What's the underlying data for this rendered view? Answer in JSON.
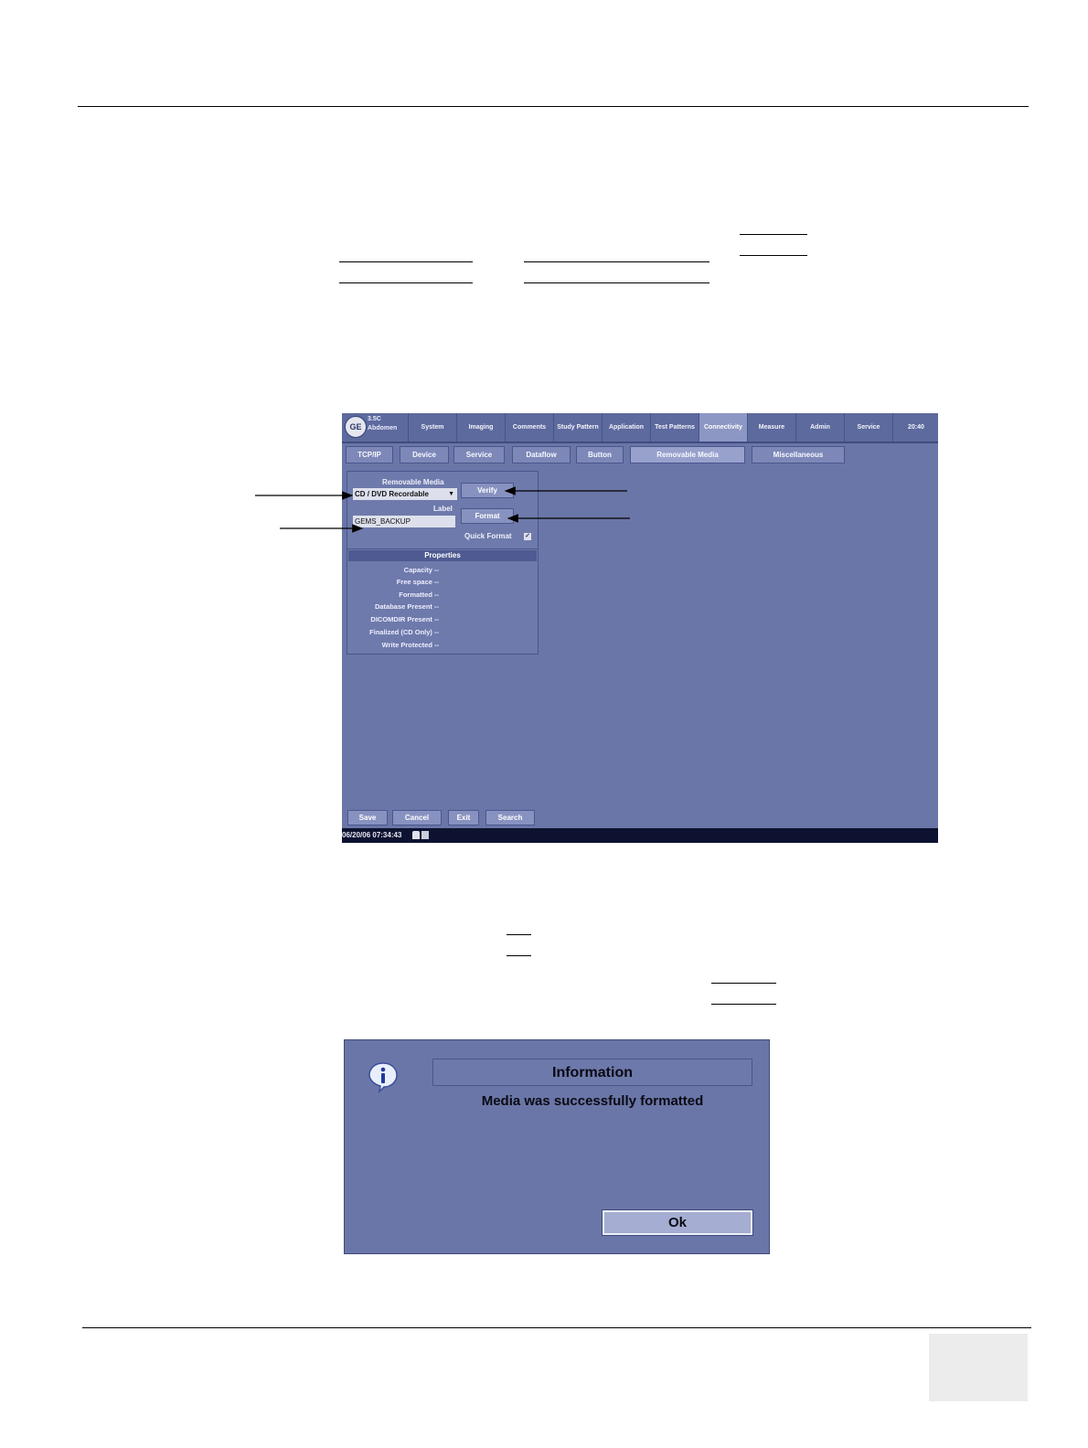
{
  "screen": {
    "probe": [
      "3.5C",
      "Abdomen"
    ],
    "top_tabs": [
      "System",
      "Imaging",
      "Comments",
      "Study Pattern",
      "Application",
      "Test Patterns",
      "Connectivity",
      "Measure",
      "Admin",
      "Service",
      "20:40"
    ],
    "active_top_tab": "Connectivity",
    "sub_tabs": [
      "TCP/IP",
      "Device",
      "Service",
      "Dataflow",
      "Button",
      "Removable Media",
      "Miscellaneous"
    ],
    "active_sub_tab": "Removable Media",
    "removable_media_label": "Removable Media",
    "media_value": "CD / DVD Recordable",
    "label_label": "Label",
    "label_value": "GEMS_BACKUP",
    "verify_label": "Verify",
    "format_label": "Format",
    "quick_format_label": "Quick Format",
    "quick_format_checked": true,
    "properties_header": "Properties",
    "properties": [
      "Capacity --",
      "Free space --",
      "Formatted --",
      "Database Present --",
      "DICOMDIR Present --",
      "Finalized (CD Only) --",
      "Write Protected --"
    ],
    "bottom_buttons": [
      "Save",
      "Cancel",
      "Exit",
      "Search"
    ],
    "status_text": "06/20/06 07:34:43"
  },
  "dialog": {
    "title": "Information",
    "message": "Media was successfully formatted",
    "ok_label": "Ok",
    "icon": "info-icon"
  },
  "colors": {
    "screen_bg": "#6a76a7",
    "status_bar": "#0d1230",
    "active_tab": "#8d97c4"
  }
}
